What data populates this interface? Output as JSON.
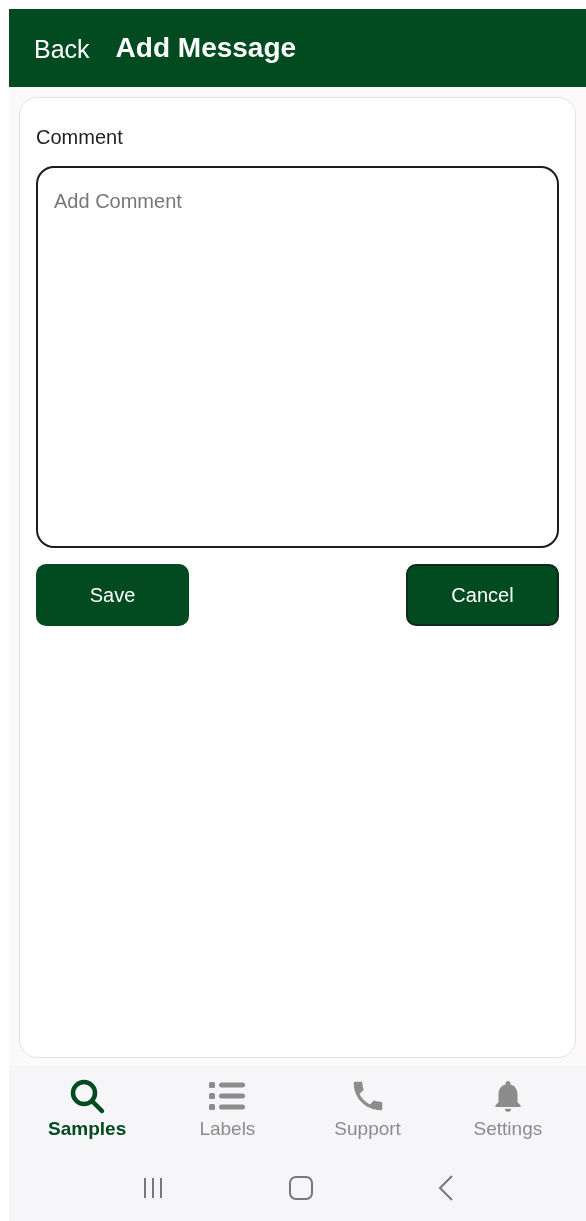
{
  "header": {
    "back": "Back",
    "title": "Add Message"
  },
  "form": {
    "label": "Comment",
    "comment": {
      "placeholder": "Add Comment"
    },
    "buttons": [
      "Save",
      "Cancel"
    ]
  },
  "bottom_nav": [
    {
      "label": "Samples",
      "selected": true
    },
    {
      "label": "Labels",
      "selected": false
    },
    {
      "label": "Support",
      "selected": false
    },
    {
      "label": "Settings",
      "selected": false
    }
  ]
}
